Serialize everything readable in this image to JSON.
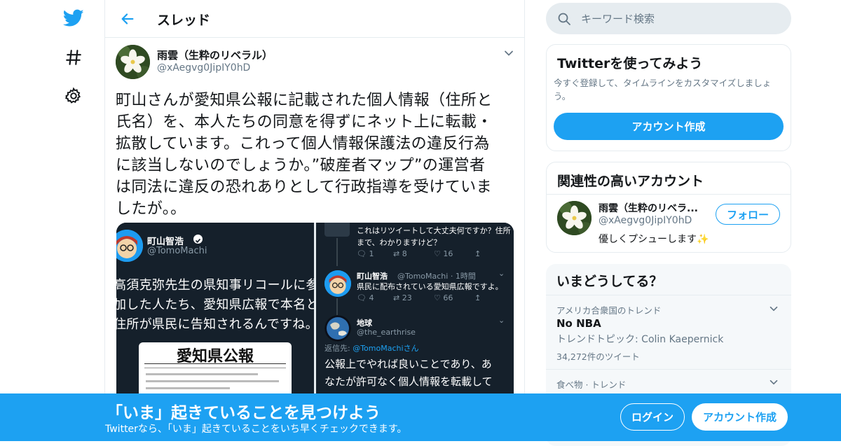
{
  "nav": {
    "icons": [
      "twitter-logo",
      "hashtag-icon",
      "gear-icon"
    ]
  },
  "header": {
    "title": "スレッド"
  },
  "tweet": {
    "author_name": "雨雲（生粋のリベラル）",
    "author_handle": "@xAegvg0JipIY0hD",
    "text_lines": [
      "町山さんが愛知県公報に記載された個人情報（住所と",
      "氏名）を、本人たちの同意を得ずにネット上に転載・",
      "拡散しています。これって個人情報保護法の違反行為",
      "に該当しないのでしょうか。”破産者マップ”の運営者",
      "は同法に違反の恐れありとして行政指導を受けていま",
      "したが。。"
    ],
    "media_left": {
      "name": "町山智浩",
      "handle": "@TomoMachi",
      "text_lines": [
        "高須克弥先生の県知事リコールに参",
        "加した人たち、愛知県広報で本名と",
        "住所が県民に告知されるんですね。"
      ],
      "doc_title": "愛知県公報"
    },
    "media_right": {
      "top_text_lines": [
        "これはリツイートして大丈夫何ですか？住所",
        "まで、わかりますけど？"
      ],
      "stats1": {
        "reply": "1",
        "retweet": "8",
        "like": "16"
      },
      "reply1_name": "町山智浩",
      "reply1_meta": "@TomoMachi · 1時間",
      "reply1_text": "県民に配布されている愛知県広報ですよ。",
      "stats2": {
        "reply": "4",
        "retweet": "23",
        "like": "66"
      },
      "reply2_name": "地球",
      "reply2_handle": "@the_earthrise",
      "reply_to_prefix": "返信先: ",
      "reply_to_handle": "@TomoMachiさん",
      "reply2_text_lines": [
        "公報上でやれば良いことであり、あ",
        "なたが許可なく個人情報を転載して"
      ]
    }
  },
  "search": {
    "placeholder": "キーワード検索"
  },
  "signup_card": {
    "title": "Twitterを使ってみよう",
    "desc_lines": [
      "今すぐ登録して、タイムラインをカスタマイズしましょ",
      "う。"
    ],
    "button": "アカウント作成"
  },
  "related_card": {
    "title": "関連性の高いアカウント",
    "name": "雨雲（生粋のリベラ...",
    "handle": "@xAegvg0JipIY0hD",
    "bio": "優しくプシューします✨",
    "follow_button": "フォロー"
  },
  "trends": {
    "title": "いまどうしてる？",
    "items": [
      {
        "context": "アメリカ合衆国のトレンド",
        "name": "No NBA",
        "topic": "トレンドトピック: Colin Kaepernick",
        "count": "34,272件のツイート"
      },
      {
        "context": "食べ物 · トレンド"
      }
    ]
  },
  "banner": {
    "title": "「いま」起きていることを見つけよう",
    "subtitle": "Twitterなら、「いま」起きていることをいち早くチェックできます。",
    "login": "ログイン",
    "signup": "アカウント作成"
  },
  "colors": {
    "brand": "#1da1f2",
    "border": "#e6ecf0",
    "secondary_text": "#657786",
    "media_bg": "#15202b"
  }
}
